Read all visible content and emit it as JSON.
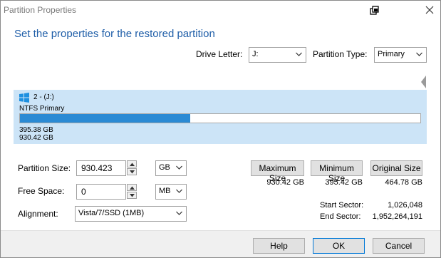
{
  "window": {
    "title": "Partition Properties"
  },
  "heading": "Set the properties for the restored partition",
  "drive_letter": {
    "label": "Drive Letter:",
    "value": "J:"
  },
  "partition_type": {
    "label": "Partition Type:",
    "value": "Primary"
  },
  "partition": {
    "name": "2 -  (J:)",
    "fs": "NTFS Primary",
    "used": "395.38 GB",
    "total": "930.42 GB",
    "used_fraction": 0.425,
    "bar_color": "#2a8ad4",
    "panel_color": "#cce4f7"
  },
  "size_fields": {
    "partition_size": {
      "label": "Partition Size:",
      "value": "930.423",
      "unit": "GB"
    },
    "free_space": {
      "label": "Free Space:",
      "value": "0",
      "unit": "MB"
    },
    "alignment": {
      "label": "Alignment:",
      "value": "Vista/7/SSD (1MB)"
    }
  },
  "size_buttons": {
    "max": {
      "label": "Maximum Size",
      "value": "930.42 GB"
    },
    "min": {
      "label": "Minimum Size",
      "value": "395.42 GB"
    },
    "orig": {
      "label": "Original Size",
      "value": "464.78 GB"
    }
  },
  "sectors": {
    "start_label": "Start Sector:",
    "start_value": "1,026,048",
    "end_label": "End Sector:",
    "end_value": "1,952,264,191"
  },
  "footer": {
    "help": "Help",
    "ok": "OK",
    "cancel": "Cancel"
  },
  "colors": {
    "heading": "#1f5ea8",
    "accent": "#0078d7"
  }
}
